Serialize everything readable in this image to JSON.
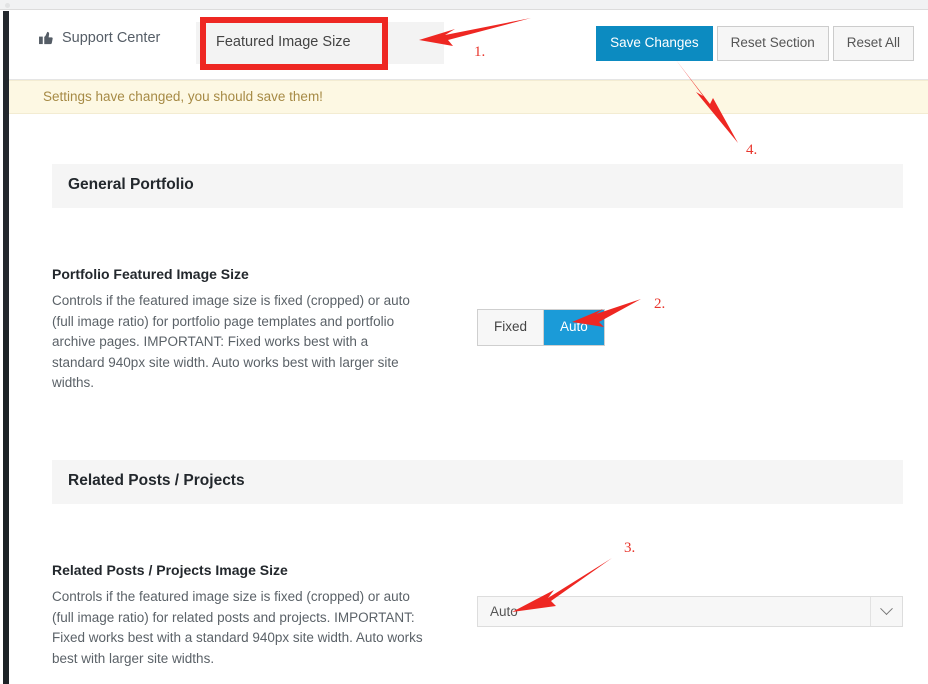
{
  "header": {
    "support_center_label": "Support Center",
    "support_center_icon": "thumbs-up-icon",
    "breadcrumb_label": "Featured Image Size",
    "buttons": {
      "save": "Save Changes",
      "reset_section": "Reset Section",
      "reset_all": "Reset All"
    },
    "accent_color": "#0c8bc1"
  },
  "notice": {
    "text": "Settings have changed, you should save them!",
    "background": "#fdf8e3",
    "text_color": "#a68a45"
  },
  "sections": [
    {
      "title": "General Portfolio",
      "field": {
        "title": "Portfolio Featured Image Size",
        "description": "Controls if the featured image size is fixed (cropped) or auto (full image ratio) for portfolio page templates and portfolio archive pages. IMPORTANT: Fixed works best with a standard 940px site width. Auto works best with larger site widths.",
        "control": "buttonset",
        "options": [
          "Fixed",
          "Auto"
        ],
        "selected": "Auto",
        "selected_color": "#1b9bd8"
      }
    },
    {
      "title": "Related Posts / Projects",
      "field": {
        "title": "Related Posts / Projects Image Size",
        "description": "Controls if the featured image size is fixed (cropped) or auto (full image ratio) for related posts and projects. IMPORTANT: Fixed works best with a standard 940px site width. Auto works best with larger site widths.",
        "control": "select",
        "selected": "Auto"
      }
    }
  ],
  "annotations": {
    "marker_color": "#ee2722",
    "items": [
      {
        "number": "1.",
        "target": "breadcrumb-label"
      },
      {
        "number": "2.",
        "target": "buttonset-auto"
      },
      {
        "number": "3.",
        "target": "related-select"
      },
      {
        "number": "4.",
        "target": "save-changes-button"
      }
    ]
  }
}
